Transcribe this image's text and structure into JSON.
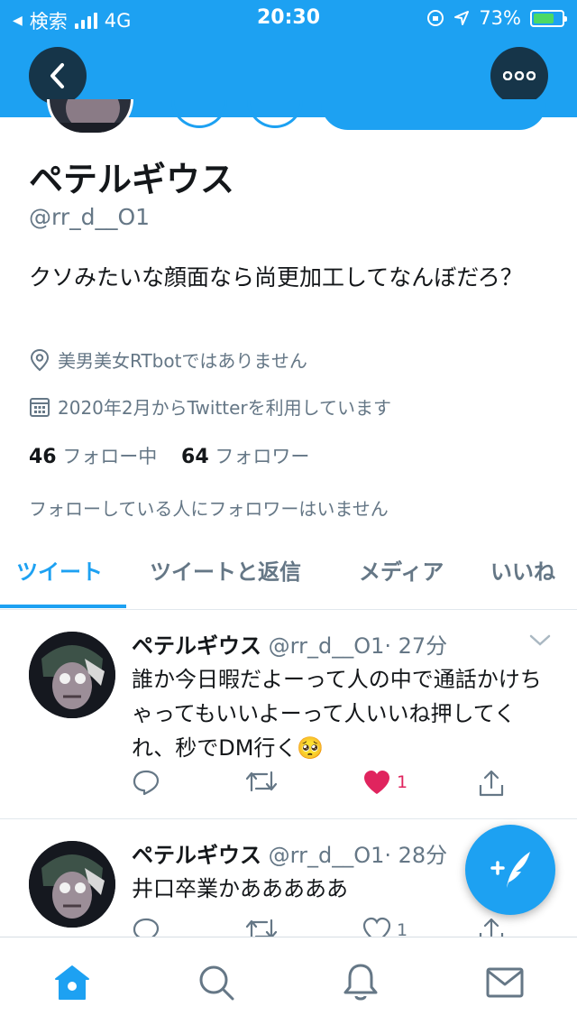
{
  "status_bar": {
    "back_app": "検索",
    "network": "4G",
    "time": "20:30",
    "battery": "73%",
    "battery_level": 0.73
  },
  "profile": {
    "name": "ペテルギウス",
    "handle": "@rr_d__O1",
    "bio": "クソみたいな顔面なら尚更加工してなんぼだろ？",
    "location": "美男美女RTbotではありません",
    "joined": "2020年2月からTwitterを利用しています",
    "following_count": "46",
    "following_label": "フォロー中",
    "followers_count": "64",
    "followers_label": "フォロワー",
    "followers_notice": "フォローしている人にフォロワーはいません"
  },
  "tabs": [
    {
      "label": "ツイート",
      "active": true
    },
    {
      "label": "ツイートと返信",
      "active": false
    },
    {
      "label": "メディア",
      "active": false
    },
    {
      "label": "いいね",
      "active": false
    }
  ],
  "tweets": [
    {
      "name": "ペテルギウス",
      "handle": "@rr_d__O1",
      "time": "· 27分",
      "text": "誰か今日暇だよーって人の中で通話かけちゃってもいいよーって人いいね押してくれ、秒でDM行く🥺",
      "like_count": "1",
      "liked": true
    },
    {
      "name": "ペテルギウス",
      "handle": "@rr_d__O1",
      "time": "· 28分",
      "text": "井口卒業かあああああ",
      "like_count": "1",
      "liked": false
    }
  ],
  "colors": {
    "accent": "#1da1f2",
    "like": "#e0245e",
    "text": "#14171a",
    "secondary": "#657786"
  },
  "icons": {
    "back": "chevron-left-icon",
    "more": "more-dots-icon",
    "location": "location-pin-icon",
    "calendar": "calendar-icon",
    "reply": "reply-icon",
    "retweet": "retweet-icon",
    "like": "heart-icon",
    "share": "share-icon",
    "compose": "compose-tweet-icon",
    "home": "home-icon",
    "search": "search-icon",
    "notifications": "bell-icon",
    "messages": "envelope-icon"
  }
}
